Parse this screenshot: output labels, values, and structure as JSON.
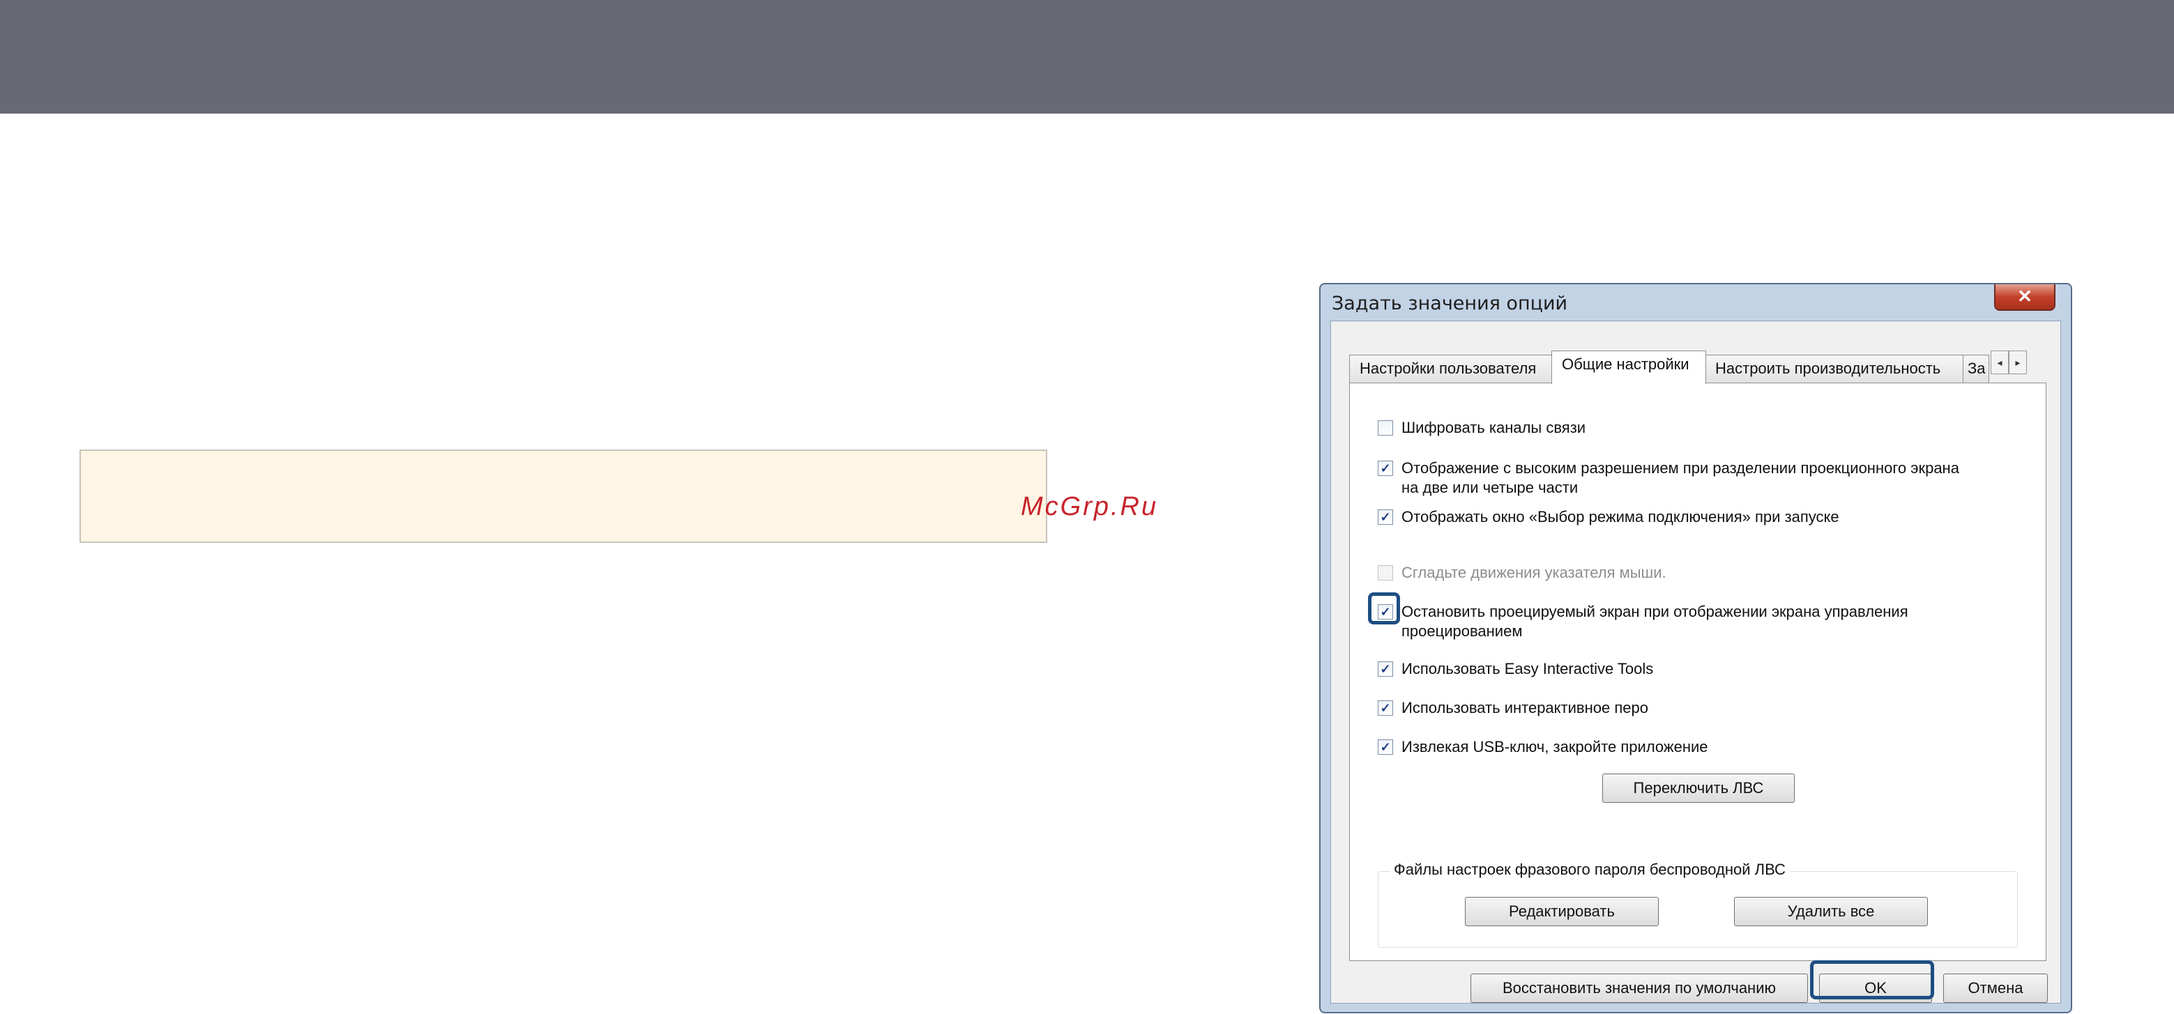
{
  "page": {
    "watermark": "McGrp.Ru"
  },
  "dialog": {
    "title": "Задать значения опций",
    "close_glyph": "✕",
    "tabs": [
      "Настройки пользователя",
      "Общие настройки",
      "Настроить производительность",
      "За"
    ],
    "active_tab": "Общие настройки",
    "tab_scroll_left": "◂",
    "tab_scroll_right": "▸",
    "options": [
      {
        "label": "Шифровать каналы связи",
        "checked": false,
        "enabled": true
      },
      {
        "label": "Отображение с высоким разрешением при разделении проекционного экрана",
        "label2": "на две или четыре части",
        "checked": true,
        "enabled": true
      },
      {
        "label": "Отображать окно «Выбор режима подключения» при запуске",
        "checked": true,
        "enabled": true
      },
      {
        "label": "Сгладьте движения указателя мыши.",
        "checked": false,
        "enabled": false
      },
      {
        "label": "Остановить проецируемый экран при отображении экрана управления",
        "label2": "проецированием",
        "checked": true,
        "enabled": true
      },
      {
        "label": "Использовать Easy Interactive Tools",
        "checked": true,
        "enabled": true
      },
      {
        "label": "Использовать интерактивное перо",
        "checked": true,
        "enabled": true
      },
      {
        "label": "Извлекая USB-ключ, закройте приложение",
        "checked": true,
        "enabled": true
      }
    ],
    "check_glyph": "✓",
    "switch_lan_button": "Переключить ЛВС",
    "group": {
      "legend": "Файлы настроек фразового пароля беспроводной ЛВС",
      "edit_button": "Редактировать",
      "delete_all_button": "Удалить все"
    },
    "restore_defaults_button": "Восстановить значения по умолчанию",
    "ok_button": "OK",
    "cancel_button": "Отмена"
  },
  "colors": {
    "top_band": "#676a73",
    "note_box": "#fff5e4",
    "watermark": "#c8242b",
    "highlight": "#1d4d82"
  }
}
